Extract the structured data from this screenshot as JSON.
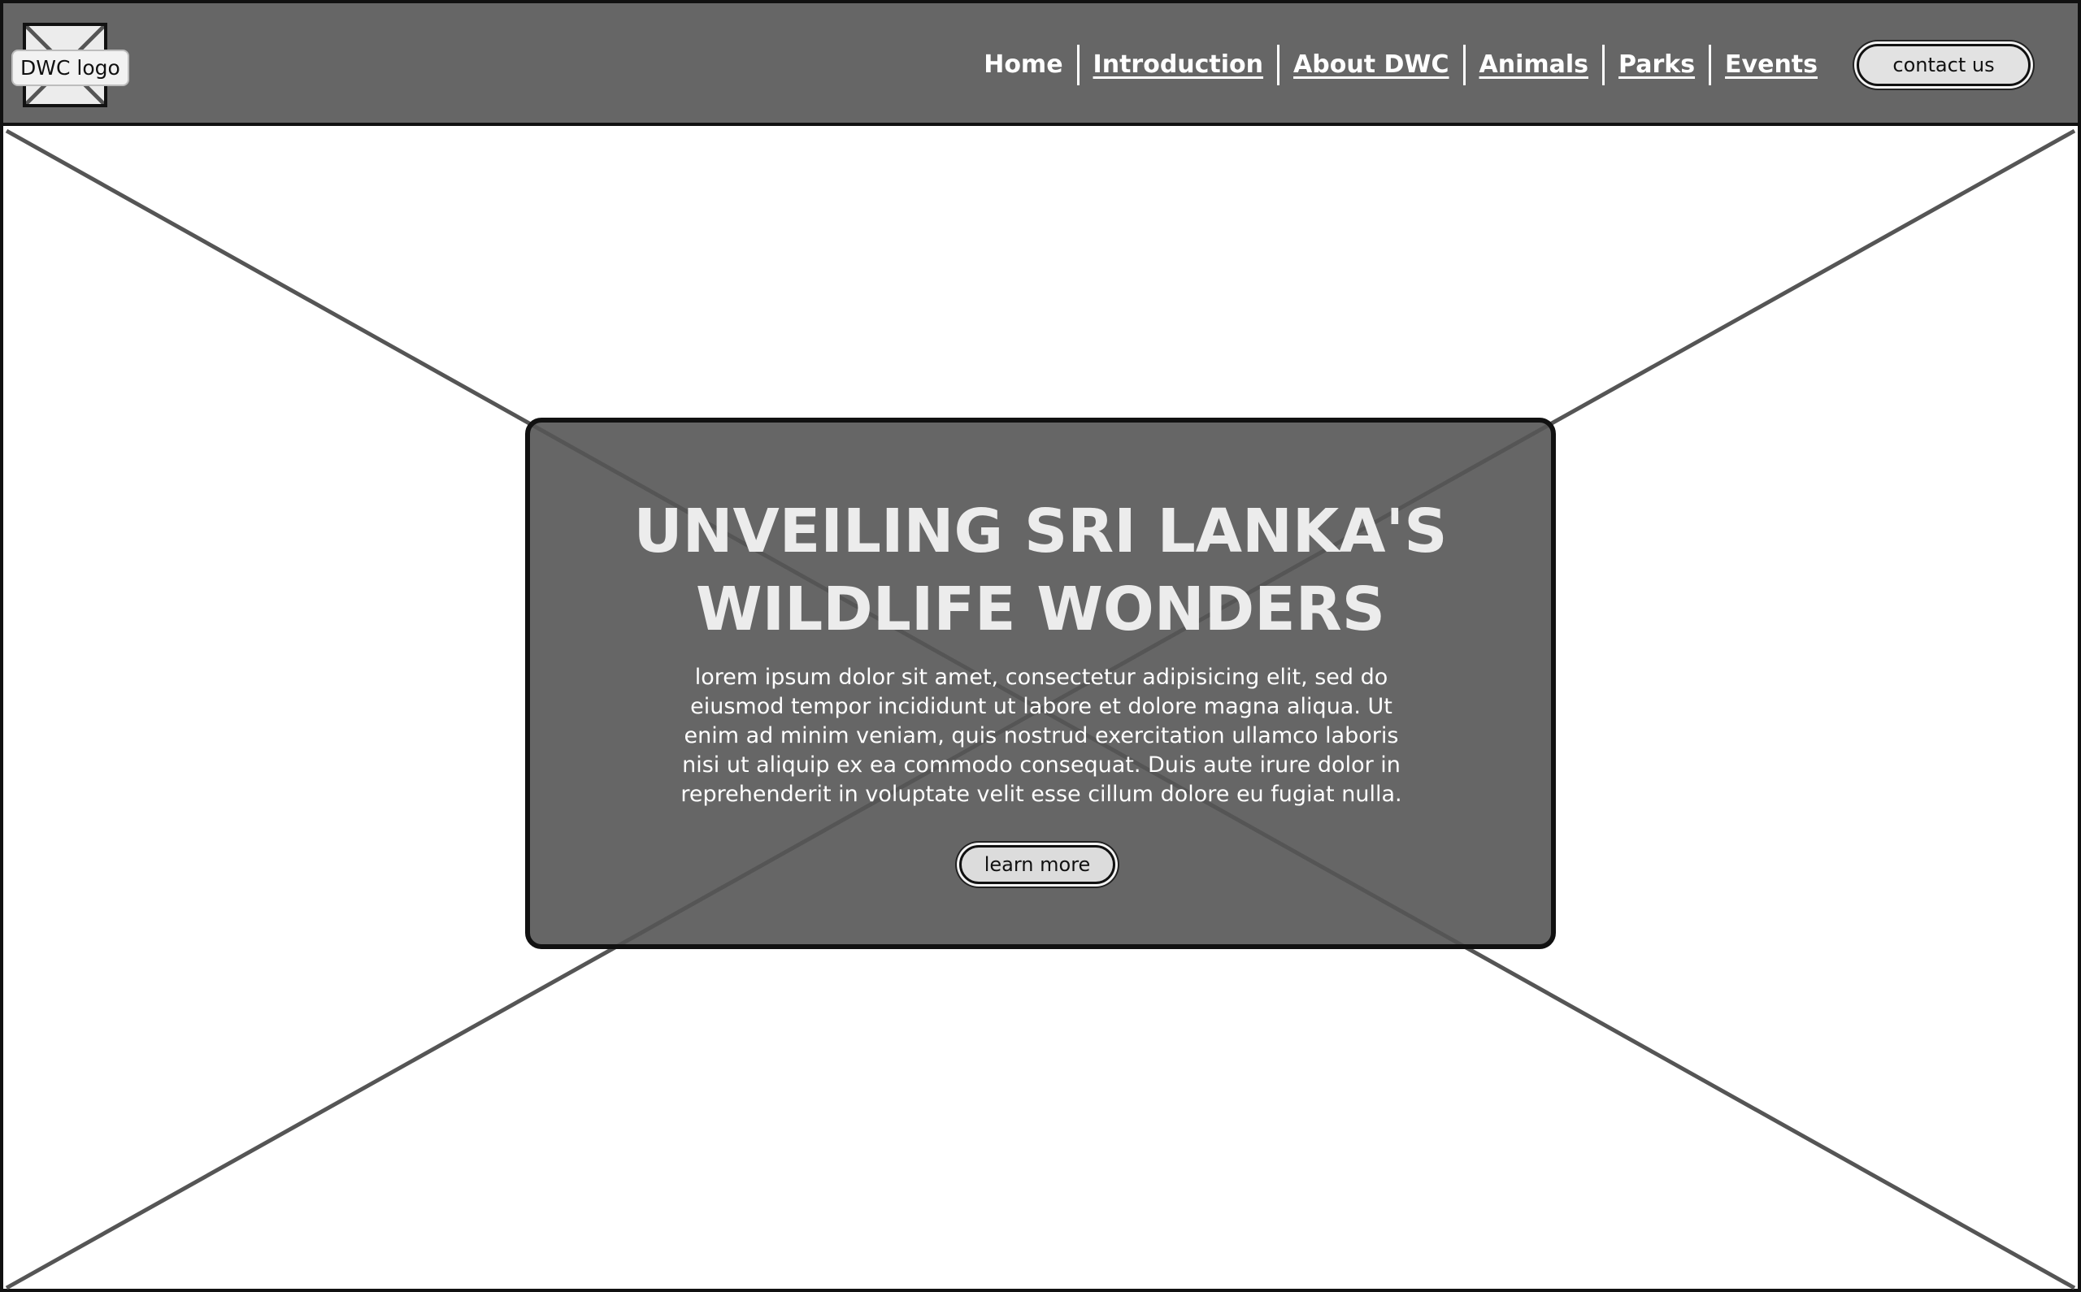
{
  "header": {
    "logo_label": "DWC logo",
    "nav_items": [
      "Home",
      "Introduction",
      "About DWC",
      "Animals",
      "Parks",
      "Events"
    ],
    "contact_label": "contact us"
  },
  "hero": {
    "title": "UNVEILING SRI LANKA'S WILDLIFE WONDERS",
    "body": "lorem ipsum dolor sit amet, consectetur adipisicing elit, sed do eiusmod tempor incididunt ut labore et dolore magna aliqua. Ut enim ad minim veniam, quis nostrud exercitation ullamco laboris nisi ut aliquip ex ea commodo consequat. Duis aute irure dolor in reprehenderit in voluptate velit esse cillum dolore eu fugiat nulla.",
    "button_label": "learn more"
  },
  "colors": {
    "header_bg": "#666666",
    "card_bg": "#555555",
    "button_bg": "#e2e2e2",
    "placeholder_line": "#555555"
  },
  "icons": {
    "logo": "image-placeholder-icon",
    "hero": "image-placeholder-icon"
  }
}
